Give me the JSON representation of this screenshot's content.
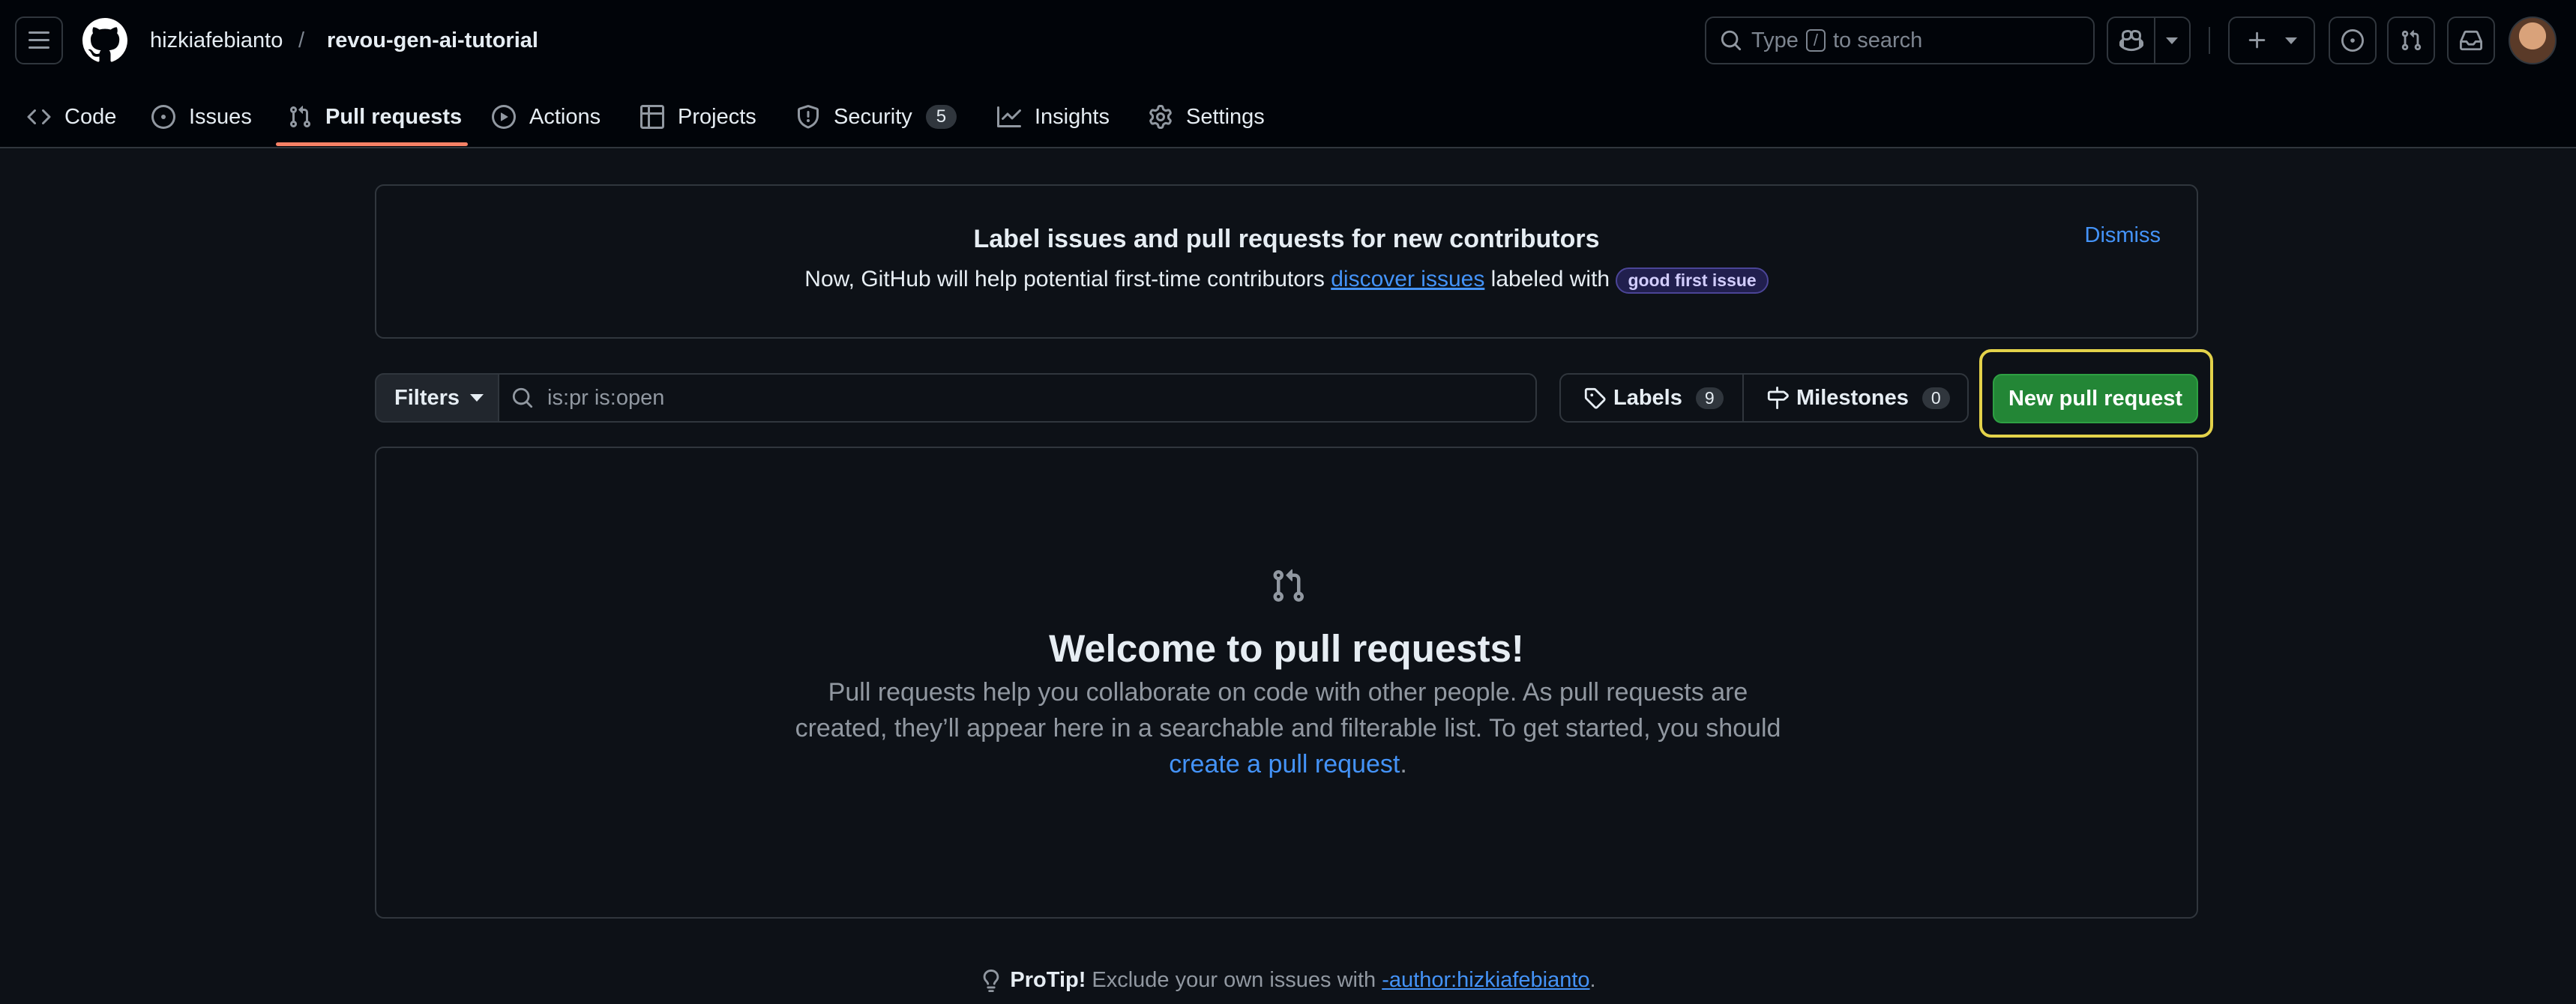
{
  "header": {
    "owner": "hizkiafebianto",
    "separator": "/",
    "repo": "revou-gen-ai-tutorial",
    "search_prefix": "Type",
    "search_key": "/",
    "search_suffix": "to search"
  },
  "nav": {
    "tabs": [
      {
        "label": "Code",
        "icon": "code-icon"
      },
      {
        "label": "Issues",
        "icon": "issue-opened-icon"
      },
      {
        "label": "Pull requests",
        "icon": "git-pull-request-icon",
        "active": true
      },
      {
        "label": "Actions",
        "icon": "play-icon"
      },
      {
        "label": "Projects",
        "icon": "table-icon"
      },
      {
        "label": "Security",
        "icon": "shield-icon",
        "count": "5"
      },
      {
        "label": "Insights",
        "icon": "graph-icon"
      },
      {
        "label": "Settings",
        "icon": "gear-icon"
      }
    ]
  },
  "banner": {
    "title": "Label issues and pull requests for new contributors",
    "text_before": "Now, GitHub will help potential first-time contributors",
    "link": "discover issues",
    "text_after": "labeled with",
    "label": "good first issue",
    "dismiss": "Dismiss"
  },
  "filter_bar": {
    "filters_label": "Filters",
    "query": "is:pr is:open",
    "labels_label": "Labels",
    "labels_count": "9",
    "milestones_label": "Milestones",
    "milestones_count": "0",
    "new_pr_label": "New pull request"
  },
  "empty_state": {
    "title": "Welcome to pull requests!",
    "text": "Pull requests help you collaborate on code with other people. As pull requests are created, they’ll appear here in a searchable and filterable list. To get started, you should",
    "link": "create a pull request",
    "end": "."
  },
  "protip": {
    "label": "ProTip!",
    "text": "Exclude your own issues with",
    "link": "-author:hizkiafebianto",
    "end": "."
  },
  "colors": {
    "background": "#0d1117",
    "header": "#010409",
    "border": "#30363d",
    "accent_link": "#4493f8",
    "primary_button": "#238636",
    "tab_underline": "#f78166",
    "highlight_ring": "#e3d24a"
  }
}
